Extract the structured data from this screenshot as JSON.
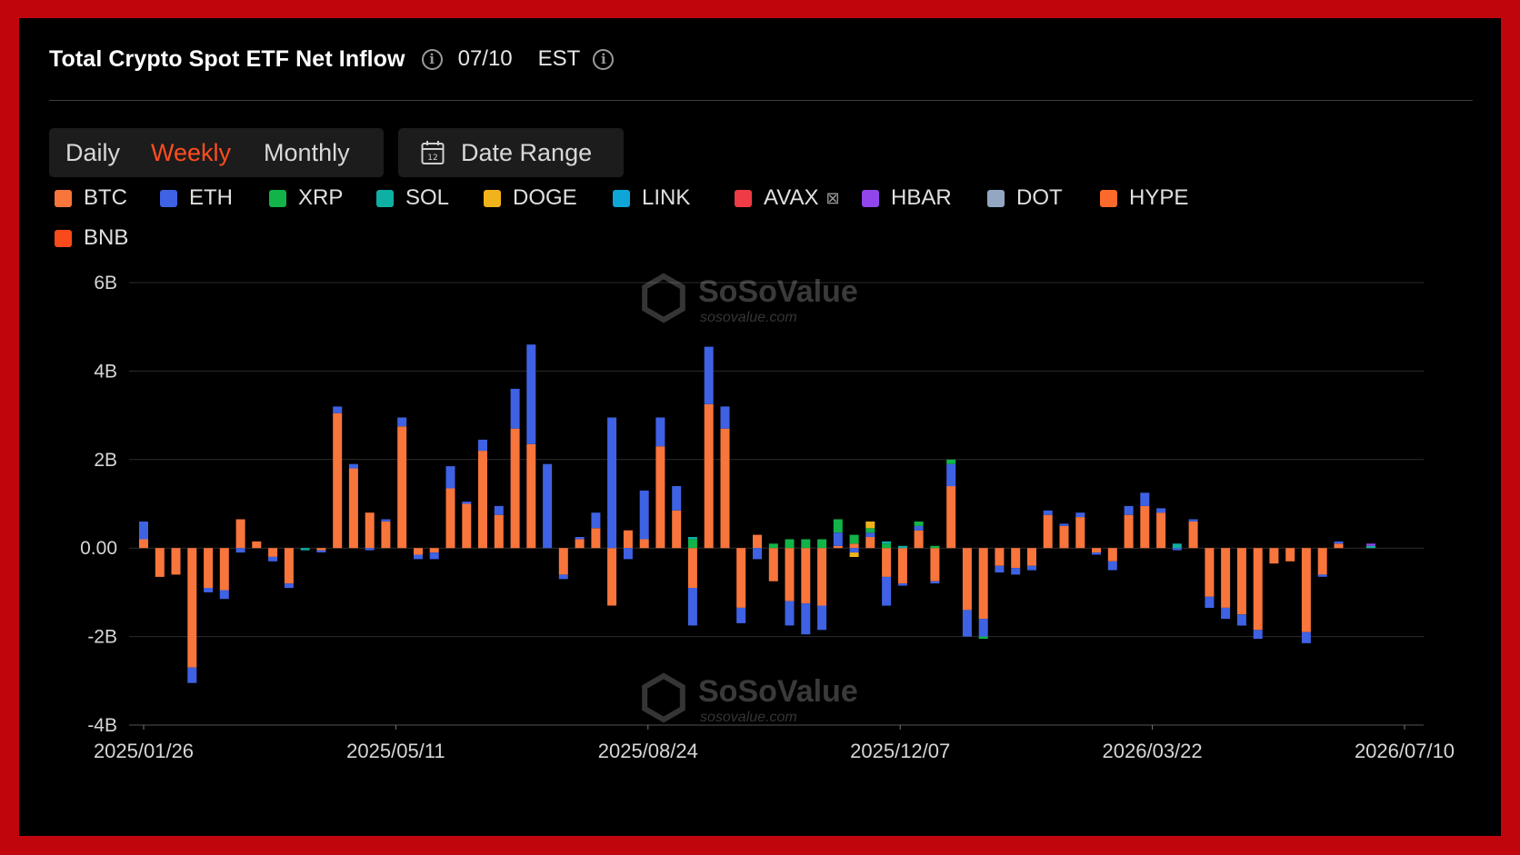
{
  "header": {
    "title": "Total Crypto Spot ETF Net Inflow",
    "date": "07/10",
    "timezone": "EST"
  },
  "period_tabs": [
    {
      "label": "Daily",
      "active": false
    },
    {
      "label": "Weekly",
      "active": true
    },
    {
      "label": "Monthly",
      "active": false
    }
  ],
  "date_range_label": "Date Range",
  "watermark": {
    "brand": "SoSoValue",
    "site": "sosovalue.com"
  },
  "colors": {
    "BTC": "#f8753c",
    "ETH": "#3e62e3",
    "XRP": "#12b349",
    "SOL": "#0fb0a4",
    "DOGE": "#f1b31b",
    "LINK": "#0ea5d8",
    "AVAX": "#ef3b45",
    "HBAR": "#9146ec",
    "DOT": "#93a7c2",
    "HYPE": "#fb6a2a",
    "BNB": "#f94a1c",
    "background": "#000000",
    "frame": "#c0060c",
    "active_tab": "#ff4d1f"
  },
  "legend": [
    {
      "label": "BTC",
      "color": "#f8753c"
    },
    {
      "label": "ETH",
      "color": "#3e62e3"
    },
    {
      "label": "XRP",
      "color": "#12b349"
    },
    {
      "label": "SOL",
      "color": "#0fb0a4"
    },
    {
      "label": "DOGE",
      "color": "#f1b31b"
    },
    {
      "label": "LINK",
      "color": "#0ea5d8"
    },
    {
      "label": "AVAX",
      "color": "#ef3b45"
    },
    {
      "label": "HBAR",
      "color": "#9146ec"
    },
    {
      "label": "DOT",
      "color": "#93a7c2"
    },
    {
      "label": "HYPE",
      "color": "#fb6a2a"
    },
    {
      "label": "BNB",
      "color": "#f94a1c"
    }
  ],
  "chart_data": {
    "type": "bar",
    "stacked": true,
    "unit": "B",
    "ylim": [
      -4,
      6
    ],
    "yticks": [
      -4,
      -2,
      0,
      2,
      4,
      6
    ],
    "ytick_labels": [
      "-4B",
      "-2B",
      "0.00",
      "2B",
      "4B",
      "6B"
    ],
    "xtick_labels": [
      "2025/01/26",
      "2025/05/11",
      "2025/08/24",
      "2025/12/07",
      "2026/03/22",
      "2026/07/10"
    ],
    "grid": true,
    "legend_position": "top",
    "categories": [
      "2025/01/26",
      "2025/02/02",
      "2025/02/09",
      "2025/02/16",
      "2025/02/23",
      "2025/03/02",
      "2025/03/09",
      "2025/03/16",
      "2025/03/23",
      "2025/03/30",
      "2025/04/06",
      "2025/04/13",
      "2025/04/20",
      "2025/04/27",
      "2025/05/04",
      "2025/05/11",
      "2025/05/18",
      "2025/05/25",
      "2025/06/01",
      "2025/06/08",
      "2025/06/15",
      "2025/06/22",
      "2025/06/29",
      "2025/07/06",
      "2025/07/13",
      "2025/07/20",
      "2025/07/27",
      "2025/08/03",
      "2025/08/10",
      "2025/08/17",
      "2025/08/24",
      "2025/08/31",
      "2025/09/07",
      "2025/09/14",
      "2025/09/21",
      "2025/09/28",
      "2025/10/05",
      "2025/10/12",
      "2025/10/19",
      "2025/10/26",
      "2025/11/02",
      "2025/11/09",
      "2025/11/16",
      "2025/11/23",
      "2025/11/30",
      "2025/12/07",
      "2025/12/14",
      "2025/12/21",
      "2025/12/28",
      "2026/01/04",
      "2026/01/11",
      "2026/01/18",
      "2026/01/25",
      "2026/02/01",
      "2026/02/08",
      "2026/02/15",
      "2026/02/22",
      "2026/03/01",
      "2026/03/08",
      "2026/03/15",
      "2026/03/22",
      "2026/03/29",
      "2026/04/05",
      "2026/04/12",
      "2026/04/19",
      "2026/04/26",
      "2026/05/03",
      "2026/05/10",
      "2026/05/17",
      "2026/05/24",
      "2026/05/31",
      "2026/06/07",
      "2026/06/14",
      "2026/06/21",
      "2026/06/28",
      "2026/07/05",
      "2026/07/10"
    ],
    "series": [
      {
        "name": "BTC",
        "values": [
          0.2,
          -0.65,
          -0.6,
          -2.7,
          -0.9,
          -0.95,
          0.65,
          0.15,
          -0.2,
          -0.8,
          0.0,
          -0.05,
          3.05,
          1.8,
          0.8,
          0.6,
          2.75,
          -0.15,
          -0.1,
          1.35,
          1.0,
          2.2,
          0.75,
          2.7,
          2.35,
          0.0,
          -0.6,
          0.2,
          0.45,
          -1.3,
          0.4,
          0.2,
          2.3,
          0.85,
          -0.9,
          3.25,
          2.7,
          -1.35,
          0.3,
          -0.75,
          -1.2,
          -1.25,
          -1.3,
          0.05,
          0.1,
          0.25,
          -0.65,
          -0.8,
          0.4,
          -0.75,
          1.4,
          -1.4,
          -1.6,
          -0.4,
          -0.45,
          -0.4,
          0.75,
          0.5,
          0.7,
          -0.1,
          -0.3,
          0.75,
          0.95,
          0.8,
          0.0,
          0.6,
          -1.1,
          -1.35,
          -1.5,
          -1.85,
          -0.35,
          -0.3,
          -1.9,
          -0.6,
          0.1
        ]
      },
      {
        "name": "ETH",
        "values": [
          0.4,
          0.0,
          0.0,
          -0.35,
          -0.1,
          -0.2,
          -0.1,
          0.0,
          -0.1,
          -0.1,
          0.0,
          -0.05,
          0.15,
          0.1,
          -0.05,
          0.05,
          0.2,
          -0.1,
          -0.15,
          0.5,
          0.05,
          0.25,
          0.2,
          0.9,
          2.25,
          1.9,
          -0.1,
          0.05,
          0.35,
          2.95,
          -0.25,
          1.1,
          0.65,
          0.55,
          -0.85,
          1.3,
          0.5,
          -0.35,
          -0.25,
          0.0,
          -0.55,
          -0.7,
          -0.55,
          0.3,
          -0.1,
          0.1,
          -0.65,
          -0.05,
          0.1,
          -0.05,
          0.5,
          -0.6,
          -0.4,
          -0.15,
          -0.15,
          -0.1,
          0.1,
          0.05,
          0.1,
          -0.05,
          -0.2,
          0.2,
          0.3,
          0.1,
          -0.05,
          0.05,
          -0.25,
          -0.25,
          -0.25,
          -0.2,
          0.0,
          0.0,
          -0.25,
          -0.05,
          0.05
        ]
      },
      {
        "name": "XRP",
        "values": [
          0,
          0,
          0,
          0,
          0,
          0,
          0,
          0,
          0,
          0,
          0,
          0,
          0,
          0,
          0,
          0,
          0,
          0,
          0,
          0,
          0,
          0,
          0,
          0,
          0,
          0,
          0,
          0,
          0,
          0,
          0,
          0,
          0,
          0,
          0.2,
          0,
          0,
          0,
          0,
          0.1,
          0.2,
          0.2,
          0.2,
          0.3,
          0.2,
          0.1,
          0.1,
          0.0,
          0.1,
          0.05,
          0.1,
          0,
          -0.05,
          0,
          0,
          0,
          0,
          0,
          0,
          0,
          0,
          0,
          0,
          0,
          0,
          0,
          0,
          0,
          0,
          0,
          0,
          0,
          0,
          0,
          0,
          0,
          0
        ]
      },
      {
        "name": "SOL",
        "values": [
          0,
          0,
          0,
          0,
          0,
          0,
          0,
          0,
          0,
          0,
          -0.05,
          0,
          0,
          0,
          0,
          0,
          0,
          0,
          0,
          0,
          0,
          0,
          0,
          0,
          0,
          0,
          0,
          0,
          0,
          0,
          0,
          0,
          0,
          0,
          0.05,
          0,
          0,
          0,
          0,
          0,
          0,
          0,
          0,
          0,
          0,
          0,
          0.05,
          0.05,
          0,
          0,
          0,
          0,
          0,
          0,
          0,
          0,
          0,
          0,
          0,
          0,
          0,
          0,
          0,
          0,
          0.1,
          0,
          0,
          0,
          0,
          0,
          0,
          0,
          0,
          0,
          0,
          0,
          0.05
        ]
      },
      {
        "name": "DOGE",
        "values": [
          0,
          0,
          0,
          0,
          0,
          0,
          0,
          0,
          0,
          0,
          0,
          0,
          0,
          0,
          0,
          0,
          0,
          0,
          0,
          0,
          0,
          0,
          0,
          0,
          0,
          0,
          0,
          0,
          0,
          0,
          0,
          0,
          0,
          0,
          0,
          0,
          0,
          0,
          0,
          0,
          0,
          0,
          0,
          0,
          -0.1,
          0.15,
          0,
          0,
          0,
          0,
          0,
          0,
          0,
          0,
          0,
          0,
          0,
          0,
          0,
          0,
          0,
          0,
          0,
          0,
          0,
          0,
          0,
          0,
          0,
          0,
          0,
          0,
          0,
          0,
          0,
          0,
          0
        ]
      },
      {
        "name": "LINK",
        "values": [
          0,
          0,
          0,
          0,
          0,
          0,
          0,
          0,
          0,
          0,
          0,
          0,
          0,
          0,
          0,
          0,
          0,
          0,
          0,
          0,
          0,
          0,
          0,
          0,
          0,
          0,
          0,
          0,
          0,
          0,
          0,
          0,
          0,
          0,
          0,
          0,
          0,
          0,
          0,
          0,
          0,
          0,
          0,
          0,
          0,
          0,
          0,
          0,
          0,
          0,
          0,
          0,
          0,
          0,
          0,
          0,
          0,
          0,
          0,
          0,
          0,
          0,
          0,
          0,
          0,
          0,
          0,
          0,
          0,
          0,
          0,
          0,
          0,
          0,
          0,
          0,
          0
        ]
      },
      {
        "name": "AVAX",
        "values": [
          0,
          0,
          0,
          0,
          0,
          0,
          0,
          0,
          0,
          0,
          0,
          0,
          0,
          0,
          0,
          0,
          0,
          0,
          0,
          0,
          0,
          0,
          0,
          0,
          0,
          0,
          0,
          0,
          0,
          0,
          0,
          0,
          0,
          0,
          0,
          0,
          0,
          0,
          0,
          0,
          0,
          0,
          0,
          0,
          0,
          0,
          0,
          0,
          0,
          0,
          0,
          0,
          0,
          0,
          0,
          0,
          0,
          0,
          0,
          0,
          0,
          0,
          0,
          0,
          0,
          0,
          0,
          0,
          0,
          0,
          0,
          0,
          0,
          0,
          0,
          0,
          0
        ]
      },
      {
        "name": "HBAR",
        "values": [
          0,
          0,
          0,
          0,
          0,
          0,
          0,
          0,
          0,
          0,
          0,
          0,
          0,
          0,
          0,
          0,
          0,
          0,
          0,
          0,
          0,
          0,
          0,
          0,
          0,
          0,
          0,
          0,
          0,
          0,
          0,
          0,
          0,
          0,
          0,
          0,
          0,
          0,
          0,
          0,
          0,
          0,
          0,
          0,
          0,
          0,
          0,
          0,
          0,
          0,
          0,
          0,
          0,
          0,
          0,
          0,
          0,
          0,
          0,
          0,
          0,
          0,
          0,
          0,
          0,
          0,
          0,
          0,
          0,
          0,
          0,
          0,
          0,
          0,
          0,
          0,
          0.05
        ]
      },
      {
        "name": "DOT",
        "values": [
          0,
          0,
          0,
          0,
          0,
          0,
          0,
          0,
          0,
          0,
          0,
          0,
          0,
          0,
          0,
          0,
          0,
          0,
          0,
          0,
          0,
          0,
          0,
          0,
          0,
          0,
          0,
          0,
          0,
          0,
          0,
          0,
          0,
          0,
          0,
          0,
          0,
          0,
          0,
          0,
          0,
          0,
          0,
          0,
          0,
          0,
          0,
          0,
          0,
          0,
          0,
          0,
          0,
          0,
          0,
          0,
          0,
          0,
          0,
          0,
          0,
          0,
          0,
          0,
          0,
          0,
          0,
          0,
          0,
          0,
          0,
          0,
          0,
          0,
          0,
          0,
          0
        ]
      },
      {
        "name": "HYPE",
        "values": [
          0,
          0,
          0,
          0,
          0,
          0,
          0,
          0,
          0,
          0,
          0,
          0,
          0,
          0,
          0,
          0,
          0,
          0,
          0,
          0,
          0,
          0,
          0,
          0,
          0,
          0,
          0,
          0,
          0,
          0,
          0,
          0,
          0,
          0,
          0,
          0,
          0,
          0,
          0,
          0,
          0,
          0,
          0,
          0,
          0,
          0,
          0,
          0,
          0,
          0,
          0,
          0,
          0,
          0,
          0,
          0,
          0,
          0,
          0,
          0,
          0,
          0,
          0,
          0,
          0,
          0,
          0,
          0,
          0,
          0,
          0,
          0,
          0,
          0,
          0,
          0,
          0
        ]
      },
      {
        "name": "BNB",
        "values": [
          0,
          0,
          0,
          0,
          0,
          0,
          0,
          0,
          0,
          0,
          0,
          0,
          0,
          0,
          0,
          0,
          0,
          0,
          0,
          0,
          0,
          0,
          0,
          0,
          0,
          0,
          0,
          0,
          0,
          0,
          0,
          0,
          0,
          0,
          0,
          0,
          0,
          0,
          0,
          0,
          0,
          0,
          0,
          0,
          0,
          0,
          0,
          0,
          0,
          0,
          0,
          0,
          0,
          0,
          0,
          0,
          0,
          0,
          0,
          0,
          0,
          0,
          0,
          0,
          0,
          0,
          0,
          0,
          0,
          0,
          0,
          0,
          0,
          0,
          0,
          0,
          0
        ]
      }
    ]
  }
}
